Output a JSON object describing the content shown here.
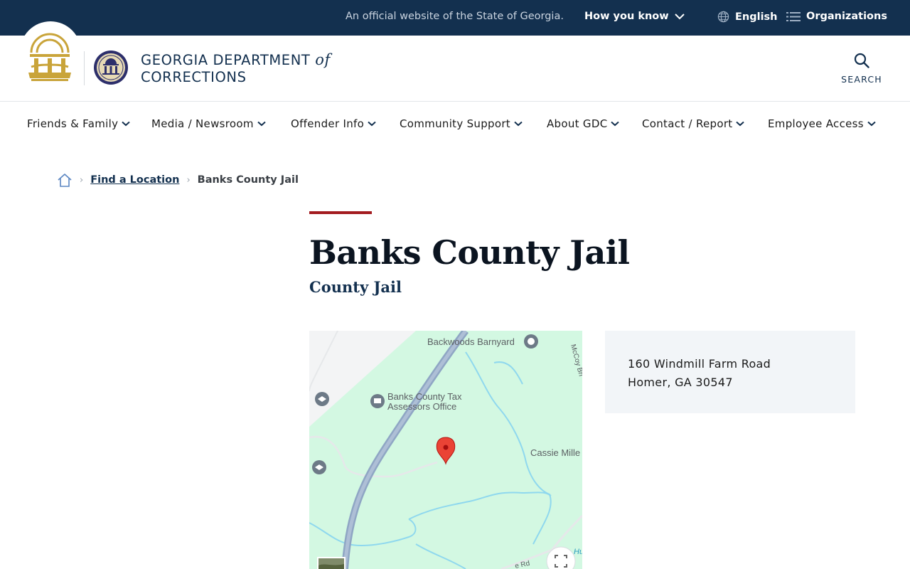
{
  "banner": {
    "official_text": "An official website of the State of Georgia.",
    "how_you_know": "How you know",
    "language": "English",
    "organizations": "Organizations"
  },
  "header": {
    "agency_line1": "GEORGIA DEPARTMENT",
    "agency_of": "of",
    "agency_line2": "CORRECTIONS",
    "search_label": "SEARCH"
  },
  "nav": {
    "items": [
      {
        "label": "Friends & Family"
      },
      {
        "label": "Media / Newsroom"
      },
      {
        "label": "Offender Info"
      },
      {
        "label": "Community Support"
      },
      {
        "label": "About GDC"
      },
      {
        "label": "Contact / Report"
      },
      {
        "label": "Employee Access"
      }
    ]
  },
  "breadcrumb": {
    "link": "Find a Location",
    "current": "Banks County Jail"
  },
  "page": {
    "title": "Banks County Jail",
    "subtitle": "County Jail"
  },
  "map": {
    "labels": {
      "backwoods": "Backwoods Barnyard",
      "tax_line1": "Banks County Tax",
      "tax_line2": "Assessors Office",
      "cassie": "Cassie Mille",
      "mccoy": "McCoy Bri",
      "rd": "e Rd",
      "hu": "Hu"
    }
  },
  "address": {
    "line1": "160 Windmill Farm Road",
    "line2": "Homer, GA 30547"
  },
  "colors": {
    "banner_bg": "#13304f",
    "accent_red": "#a31b1f",
    "map_green": "#d3f8e2",
    "map_road": "#8fa6c4",
    "gold": "#c9a43a"
  }
}
